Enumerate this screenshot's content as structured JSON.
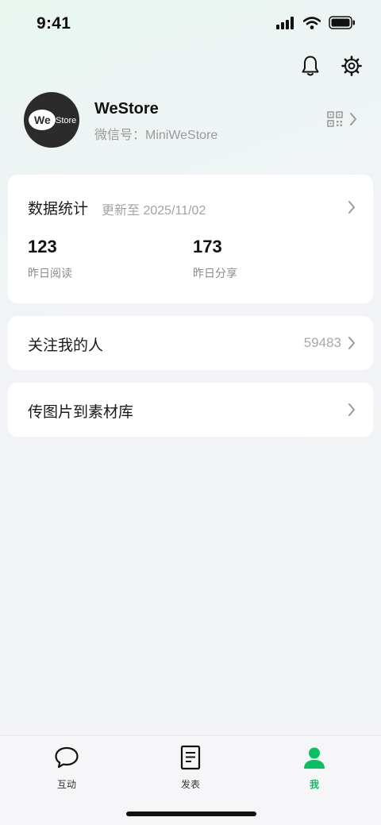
{
  "status_bar": {
    "time": "9:41"
  },
  "icons": {
    "signal": "signal-icon",
    "wifi": "wifi-icon",
    "battery": "battery-icon",
    "bell": "bell-icon",
    "gear": "gear-icon",
    "qr": "qr-code-icon",
    "chevron": "chevron-right-icon",
    "chat": "chat-bubble-icon",
    "document": "document-icon",
    "user": "user-icon"
  },
  "profile": {
    "avatar_logo_we": "We",
    "avatar_logo_store": "Store",
    "name": "WeStore",
    "wechat_id": "微信号：MiniWeStore"
  },
  "stats": {
    "title": "数据统计",
    "updated": "更新至 2025/11/02",
    "items": [
      {
        "value": "123",
        "label": "昨日阅读"
      },
      {
        "value": "173",
        "label": "昨日分享"
      }
    ]
  },
  "followers": {
    "label": "关注我的人",
    "count": "59483"
  },
  "upload": {
    "label": "传图片到素材库"
  },
  "tabbar": {
    "tabs": [
      {
        "label": "互动"
      },
      {
        "label": "发表"
      },
      {
        "label": "我"
      }
    ]
  },
  "colors": {
    "accent": "#07c160",
    "text": "#1a1a1a",
    "muted": "#a3a3a3"
  }
}
